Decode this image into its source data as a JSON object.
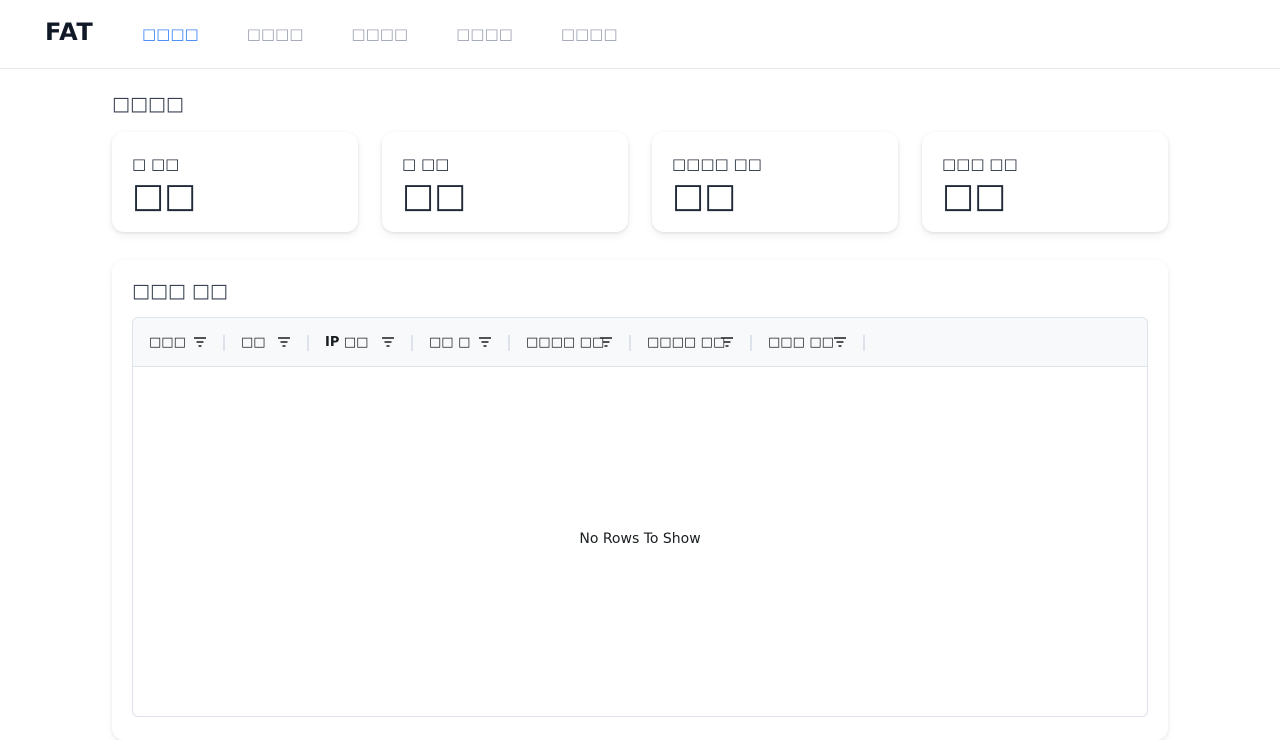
{
  "header": {
    "brand": "FAT",
    "nav": [
      {
        "label": "□□□□",
        "active": true
      },
      {
        "label": "□□□□",
        "active": false
      },
      {
        "label": "□□□□",
        "active": false
      },
      {
        "label": "□□□□",
        "active": false
      },
      {
        "label": "□□□□",
        "active": false
      }
    ]
  },
  "main": {
    "title": "□□□□",
    "stats": [
      {
        "label": "□ □□",
        "value": "□□"
      },
      {
        "label": "□ □□",
        "value": "□□"
      },
      {
        "label": "□□□□ □□",
        "value": "□□"
      },
      {
        "label": "□□□ □□",
        "value": "□□"
      }
    ],
    "table": {
      "title": "□□□ □□",
      "columns": [
        "□□□",
        "□□",
        "IP □□",
        "□□ □",
        "□□□□ □□",
        "□□□□ □□",
        "□□□ □□"
      ],
      "empty_message": "No Rows To Show"
    }
  },
  "colors": {
    "accent": "#3b82f6",
    "nav_inactive": "#9ca3af"
  }
}
